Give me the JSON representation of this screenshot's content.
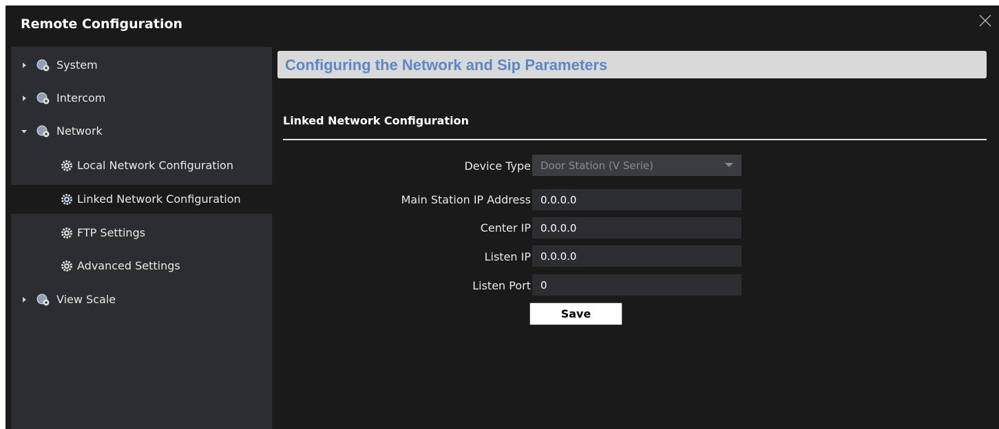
{
  "window": {
    "title": "Remote Configuration"
  },
  "sidebar": {
    "items": [
      {
        "label": "System"
      },
      {
        "label": "Intercom"
      },
      {
        "label": "Network"
      },
      {
        "label": "Local Network Configuration"
      },
      {
        "label": "Linked Network Configuration"
      },
      {
        "label": "FTP Settings"
      },
      {
        "label": "Advanced Settings"
      },
      {
        "label": "View Scale"
      }
    ]
  },
  "main": {
    "header": "Configuring the Network and Sip Parameters",
    "subheading": "Linked Network Configuration",
    "form": {
      "device_type_label": "Device Type",
      "device_type_value": "Door Station (V Serie)",
      "main_station_ip_label": "Main Station IP Address",
      "main_station_ip_value": "0.0.0.0",
      "center_ip_label": "Center IP",
      "center_ip_value": "0.0.0.0",
      "listen_ip_label": "Listen IP",
      "listen_ip_value": "0.0.0.0",
      "listen_port_label": "Listen Port",
      "listen_port_value": "0"
    },
    "save_label": "Save"
  },
  "colors": {
    "background": "#1a1a1a",
    "sidebar": "#2c2d30",
    "header_bar": "#d9d9d9",
    "header_text": "#5a88c8"
  }
}
